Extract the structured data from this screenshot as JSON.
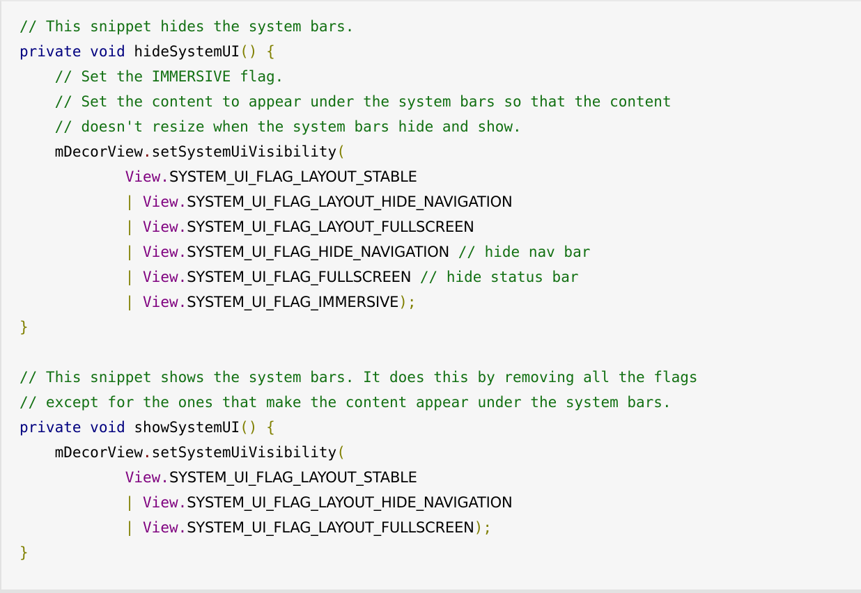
{
  "editor": {
    "language": "java",
    "background_color": "#f6f6f6",
    "border_color": "#e2e2e2",
    "colors": {
      "comment": "#127012",
      "keyword": "#00007f",
      "class_reference": "#7f007f",
      "punctuation": "#808000",
      "identifier": "#000000",
      "member_dot": "#7f0000"
    }
  },
  "code": {
    "l1_comment": "// This snippet hides the system bars.",
    "l2_kw_private": "private",
    "l2_kw_void": "void",
    "l2_method": "hideSystemUI",
    "l2_parens": "()",
    "l2_brace": "{",
    "l3_comment": "// Set the IMMERSIVE flag.",
    "l4_comment": "// Set the content to appear under the system bars so that the content",
    "l5_comment": "// doesn't resize when the system bars hide and show.",
    "l6_obj": "mDecorView",
    "l6_dot": ".",
    "l6_method": "setSystemUiVisibility",
    "l6_paren": "(",
    "l7_cls": "View",
    "l7_dot": ".",
    "l7_const": "SYSTEM_UI_FLAG_LAYOUT_STABLE",
    "l8_pipe": "|",
    "l8_cls": "View",
    "l8_dot": ".",
    "l8_const": "SYSTEM_UI_FLAG_LAYOUT_HIDE_NAVIGATION",
    "l9_pipe": "|",
    "l9_cls": "View",
    "l9_dot": ".",
    "l9_const": "SYSTEM_UI_FLAG_LAYOUT_FULLSCREEN",
    "l10_pipe": "|",
    "l10_cls": "View",
    "l10_dot": ".",
    "l10_const": "SYSTEM_UI_FLAG_HIDE_NAVIGATION",
    "l10_comment": "// hide nav bar",
    "l11_pipe": "|",
    "l11_cls": "View",
    "l11_dot": ".",
    "l11_const": "SYSTEM_UI_FLAG_FULLSCREEN",
    "l11_comment": "// hide status bar",
    "l12_pipe": "|",
    "l12_cls": "View",
    "l12_dot": ".",
    "l12_const": "SYSTEM_UI_FLAG_IMMERSIVE",
    "l12_end": ");",
    "l13_brace": "}",
    "l15_comment": "// This snippet shows the system bars. It does this by removing all the flags",
    "l16_comment": "// except for the ones that make the content appear under the system bars.",
    "l17_kw_private": "private",
    "l17_kw_void": "void",
    "l17_method": "showSystemUI",
    "l17_parens": "()",
    "l17_brace": "{",
    "l18_obj": "mDecorView",
    "l18_dot": ".",
    "l18_method": "setSystemUiVisibility",
    "l18_paren": "(",
    "l19_cls": "View",
    "l19_dot": ".",
    "l19_const": "SYSTEM_UI_FLAG_LAYOUT_STABLE",
    "l20_pipe": "|",
    "l20_cls": "View",
    "l20_dot": ".",
    "l20_const": "SYSTEM_UI_FLAG_LAYOUT_HIDE_NAVIGATION",
    "l21_pipe": "|",
    "l21_cls": "View",
    "l21_dot": ".",
    "l21_const": "SYSTEM_UI_FLAG_LAYOUT_FULLSCREEN",
    "l21_end": ");",
    "l22_brace": "}"
  }
}
